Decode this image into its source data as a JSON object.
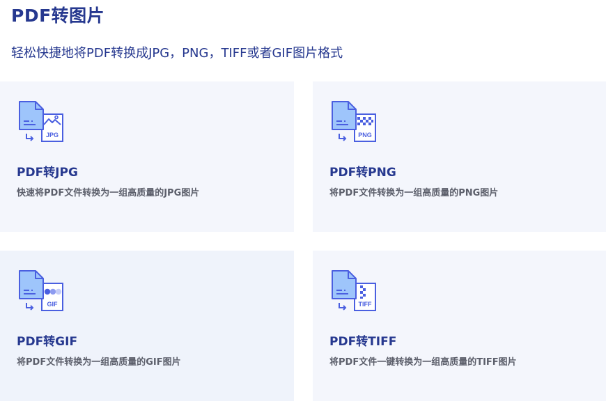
{
  "header": {
    "title": "PDF转图片",
    "subtitle": "轻松快捷地将PDF转换成JPG，PNG，TIFF或者GIF图片格式"
  },
  "colors": {
    "accent": "#26388f",
    "icon_stroke": "#4a5fe0",
    "icon_fill": "#9ec5fb",
    "card_bg": "#f4f6fc",
    "desc_text": "#5c5f6b"
  },
  "cards": [
    {
      "title": "PDF转JPG",
      "description": "快速将PDF文件转换为一组高质量的JPG图片",
      "icon": "pdf-to-jpg-icon",
      "badge": "JPG"
    },
    {
      "title": "PDF转PNG",
      "description": "将PDF文件转换为一组高质量的PNG图片",
      "icon": "pdf-to-png-icon",
      "badge": "PNG"
    },
    {
      "title": "PDF转GIF",
      "description": "将PDF文件转换为一组高质量的GIF图片",
      "icon": "pdf-to-gif-icon",
      "badge": "GIF"
    },
    {
      "title": "PDF转TIFF",
      "description": "将PDF文件一键转换为一组高质量的TIFF图片",
      "icon": "pdf-to-tiff-icon",
      "badge": "TIFF"
    }
  ]
}
